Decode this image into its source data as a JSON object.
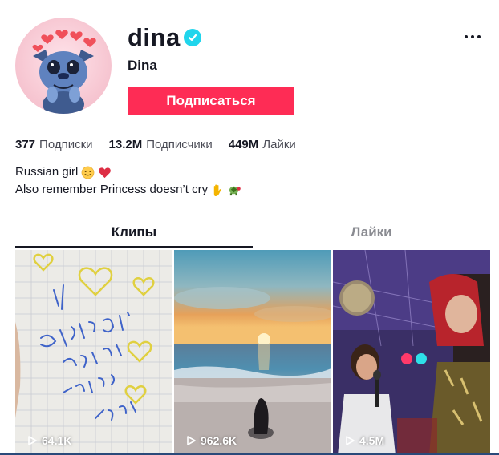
{
  "profile": {
    "username": "dina",
    "nickname": "Dina",
    "verified": true,
    "follow_label": "Подписаться",
    "avatar_icon": "stitch-avatar",
    "more_icon": "more-dots-icon"
  },
  "stats": [
    {
      "value": "377",
      "label": "Подписки"
    },
    {
      "value": "13.2M",
      "label": "Подписчики"
    },
    {
      "value": "449M",
      "label": "Лайки"
    }
  ],
  "bio": {
    "line1": "Russian girl",
    "line2": "Also remember Princess doesn’t cry"
  },
  "tabs": [
    {
      "label": "Клипы",
      "active": true
    },
    {
      "label": "Лайки",
      "active": false
    }
  ],
  "videos": [
    {
      "views": "64.1K",
      "thumb": "handwritten-note"
    },
    {
      "views": "962.6K",
      "thumb": "sunset-beach"
    },
    {
      "views": "4.5M",
      "thumb": "party-stage"
    }
  ],
  "colors": {
    "accent": "#fe2c55",
    "verified": "#20d5ec",
    "text": "#161823"
  }
}
